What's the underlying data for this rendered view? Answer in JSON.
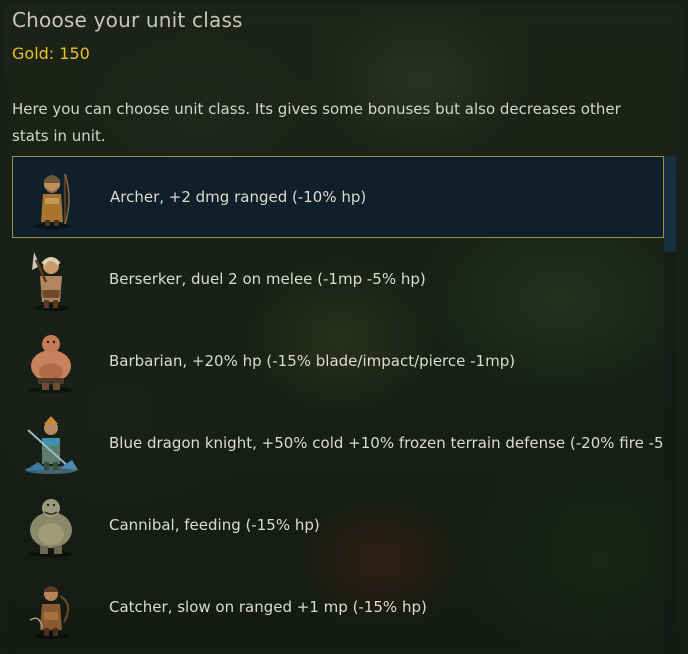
{
  "dialog": {
    "title": "Choose your unit class",
    "gold": "Gold: 150",
    "description": "Here you can choose unit class. Its gives some bonuses but also decreases other stats in unit."
  },
  "classes": [
    {
      "label": "Archer, +2 dmg ranged (-10% hp)",
      "icon": "archer-portrait-icon",
      "selected": true
    },
    {
      "label": "Berserker, duel 2 on melee (-1mp -5% hp)",
      "icon": "berserker-portrait-icon",
      "selected": false
    },
    {
      "label": "Barbarian, +20% hp (-15% blade/impact/pierce -1mp)",
      "icon": "barbarian-portrait-icon",
      "selected": false
    },
    {
      "label": "Blue dragon knight, +50% cold +10% frozen terrain defense (-20% fire -5%",
      "icon": "blue-dragon-knight-portrait-icon",
      "selected": false
    },
    {
      "label": "Cannibal, feeding (-15% hp)",
      "icon": "cannibal-portrait-icon",
      "selected": false
    },
    {
      "label": "Catcher, slow on ranged +1 mp (-15% hp)",
      "icon": "catcher-portrait-icon",
      "selected": false
    }
  ],
  "colors": {
    "title": "#c9c6b8",
    "gold": "#e5c31f",
    "text": "#d7d4c9",
    "selection_bg": "#0e202e",
    "selection_border": "#9f8c4e"
  }
}
